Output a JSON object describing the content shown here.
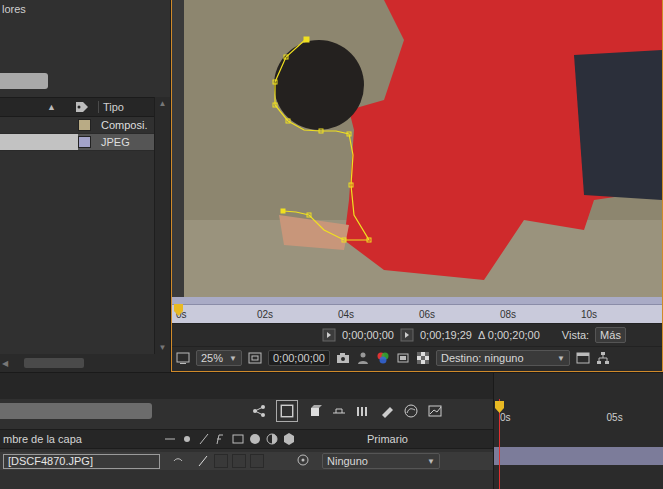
{
  "project_panel": {
    "title": "lores",
    "sort_icon": "▲",
    "column": "Tipo",
    "items": [
      {
        "type": "Composi.",
        "color": "#b9ab85",
        "selected": false
      },
      {
        "type": "JPEG",
        "color": "#a3a3c9",
        "selected": true
      }
    ]
  },
  "viewer": {
    "ruler": [
      "0s",
      "02s",
      "04s",
      "06s",
      "08s",
      "10s"
    ],
    "current_time": "0;00;00;00",
    "end_time": "0;00;19;29",
    "duration": "Δ 0;00;20;00",
    "view_label": "Vista:",
    "view_value": "Más",
    "zoom": "25%",
    "time": "0;00;00;00",
    "target": "Destino: ninguno"
  },
  "timeline": {
    "ruler": [
      "0s",
      "05s"
    ],
    "columns": {
      "name": "mbre de la capa",
      "parent": "Primario"
    },
    "layers": [
      {
        "name": "[DSCF4870.JPG]",
        "parent": "Ninguno",
        "selected": true
      }
    ]
  }
}
